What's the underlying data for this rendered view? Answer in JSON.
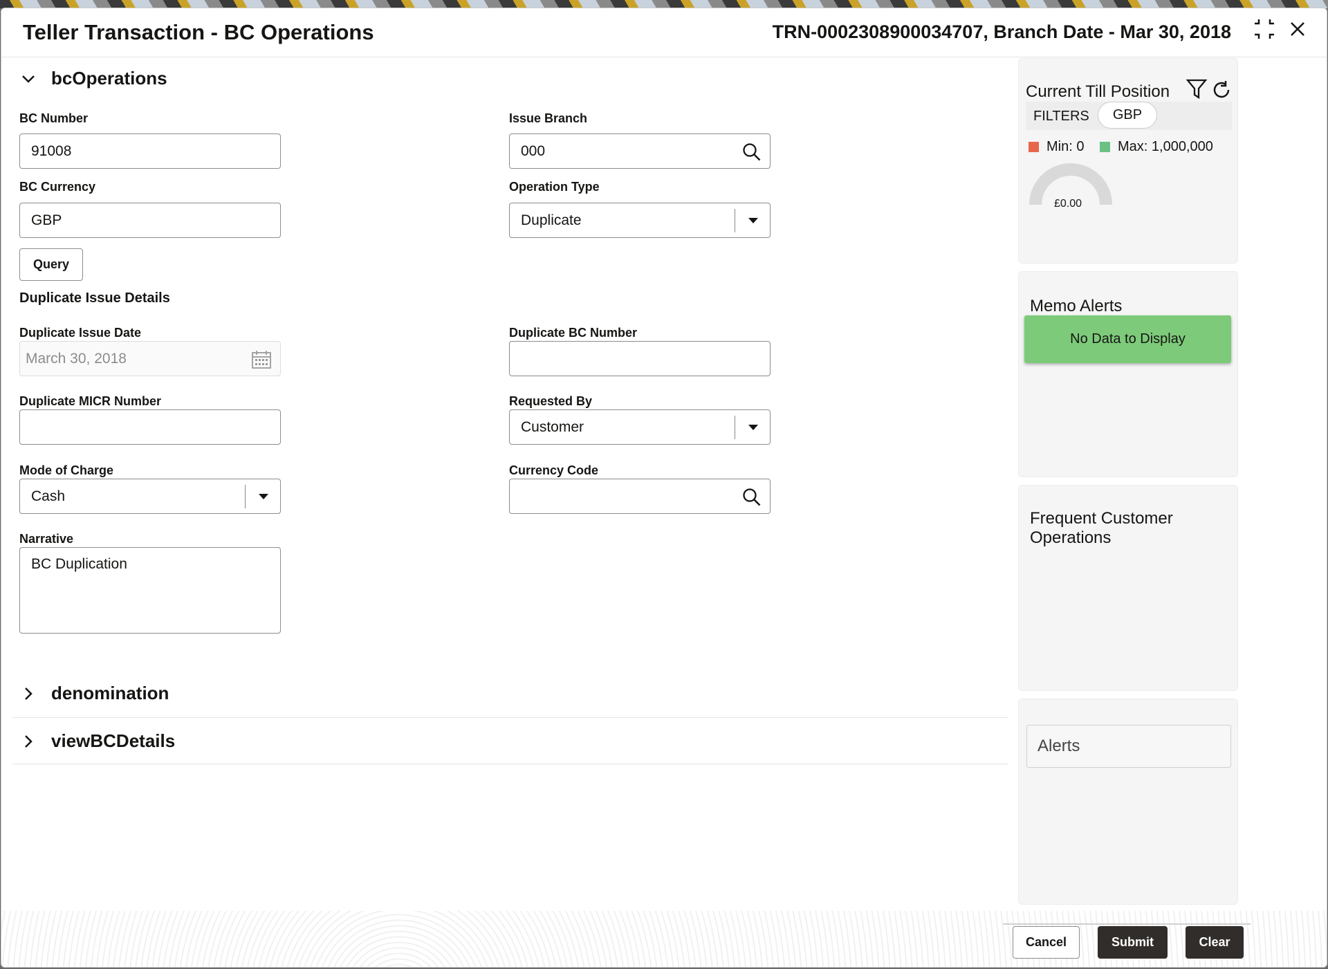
{
  "header": {
    "title": "Teller Transaction - BC Operations",
    "reference": "TRN-0002308900034707, Branch Date - Mar 30, 2018"
  },
  "sections": {
    "bc_operations": "bcOperations",
    "denomination": "denomination",
    "view_bc_details": "viewBCDetails"
  },
  "form": {
    "bc_number": {
      "label": "BC Number",
      "value": "91008"
    },
    "issue_branch": {
      "label": "Issue Branch",
      "value": "000"
    },
    "bc_currency": {
      "label": "BC Currency",
      "value": "GBP"
    },
    "operation_type": {
      "label": "Operation Type",
      "value": "Duplicate"
    },
    "query_label": "Query",
    "duplicate_heading": "Duplicate Issue Details",
    "duplicate_issue_date": {
      "label": "Duplicate Issue Date",
      "value": "March 30, 2018"
    },
    "duplicate_bc_number": {
      "label": "Duplicate BC Number",
      "value": ""
    },
    "duplicate_micr": {
      "label": "Duplicate MICR Number",
      "value": ""
    },
    "requested_by": {
      "label": "Requested By",
      "value": "Customer"
    },
    "mode_of_charge": {
      "label": "Mode of Charge",
      "value": "Cash"
    },
    "currency_code": {
      "label": "Currency Code",
      "value": ""
    },
    "narrative": {
      "label": "Narrative",
      "value": "BC Duplication"
    }
  },
  "sidebar": {
    "till": {
      "title": "Current Till Position",
      "filters": "FILTERS",
      "currency": "GBP",
      "min": "Min: 0",
      "max": "Max: 1,000,000",
      "amount": "£0.00",
      "min_color": "#e8674c",
      "max_color": "#6ac184"
    },
    "memo": {
      "title": "Memo Alerts",
      "empty": "No Data to Display"
    },
    "frequent": {
      "title": "Frequent Customer Operations"
    },
    "alerts": {
      "title": "Alerts"
    }
  },
  "footer": {
    "cancel": "Cancel",
    "submit": "Submit",
    "clear": "Clear"
  }
}
